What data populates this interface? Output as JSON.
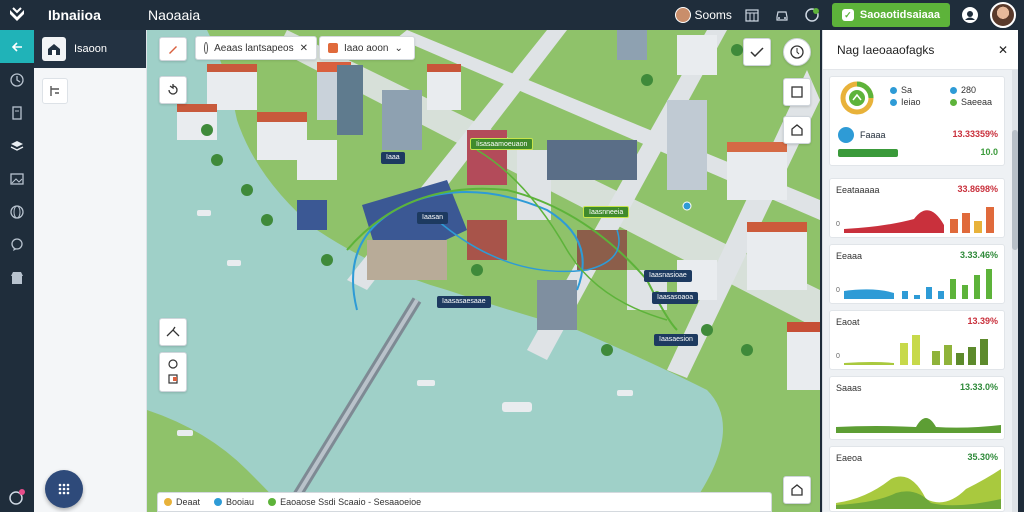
{
  "app": {
    "title": "Ibnaiioa",
    "project": "Naoaaia"
  },
  "topbar": {
    "user_name": "Sooms",
    "cta_label": "Saoaotidsaiaaa"
  },
  "subpanel": {
    "header_label": "Isaoon"
  },
  "map": {
    "search_chips": [
      {
        "text": "Aeaas lantsapeos"
      },
      {
        "text": "Iaao aoon"
      }
    ],
    "labels": [
      {
        "text": "Iaaa",
        "style": "navy"
      },
      {
        "text": "Iisasaamoeuaon",
        "style": "green"
      },
      {
        "text": "Iaasan",
        "style": "navy"
      },
      {
        "text": "Iaasnneeia",
        "style": "green"
      },
      {
        "text": "Iaasnasioae",
        "style": "navy"
      },
      {
        "text": "Iaasasaesaae",
        "style": "navy"
      },
      {
        "text": "Iaasasoaoa",
        "style": "navy"
      },
      {
        "text": "Iaasaesion",
        "style": "navy"
      }
    ],
    "legend": [
      {
        "text": "Deaat",
        "color": "#e8b23a"
      },
      {
        "text": "Booiau",
        "color": "#2e9bd6"
      },
      {
        "text": "Eaoaose Ssdi Scaaio - Sesaaoeioe",
        "color": "#5db33a"
      }
    ]
  },
  "rpanel": {
    "title": "Nag Iaeoaaofagks",
    "summary": {
      "items": [
        {
          "label": "Sa",
          "sub": "Ieiao",
          "color": "#2e9bd6"
        },
        {
          "label": "280",
          "sub": "Saeeaa",
          "color": "#2e9bd6"
        },
        {
          "label": "",
          "sub": "",
          "color": "#5db33a"
        },
        {
          "label": "",
          "sub": "",
          "color": "#5db33a"
        }
      ],
      "row_label": "Faaaa",
      "row_value": "13.33359%",
      "row_sub": "10.0"
    },
    "charts": [
      {
        "title": "Eeataaaaa",
        "value": "33.8698%",
        "value_color": "#c9303c",
        "zero": "0"
      },
      {
        "title": "Eeaaa",
        "value": "3.33.46%",
        "value_color": "#2f8a3a",
        "zero": "0"
      },
      {
        "title": "Eaoat",
        "value": "13.39%",
        "value_color": "#c9303c",
        "zero": "0"
      },
      {
        "title": "Saaas",
        "value": "13.33.0%",
        "value_color": "#2f8a3a",
        "zero": ""
      },
      {
        "title": "Eaeoa",
        "value": "35.30%",
        "value_color": "#2f8a3a",
        "zero": ""
      }
    ]
  },
  "colors": {
    "accent": "#20b3b8",
    "brand_green": "#5db33a",
    "nav_dark": "#1f2d3b"
  }
}
